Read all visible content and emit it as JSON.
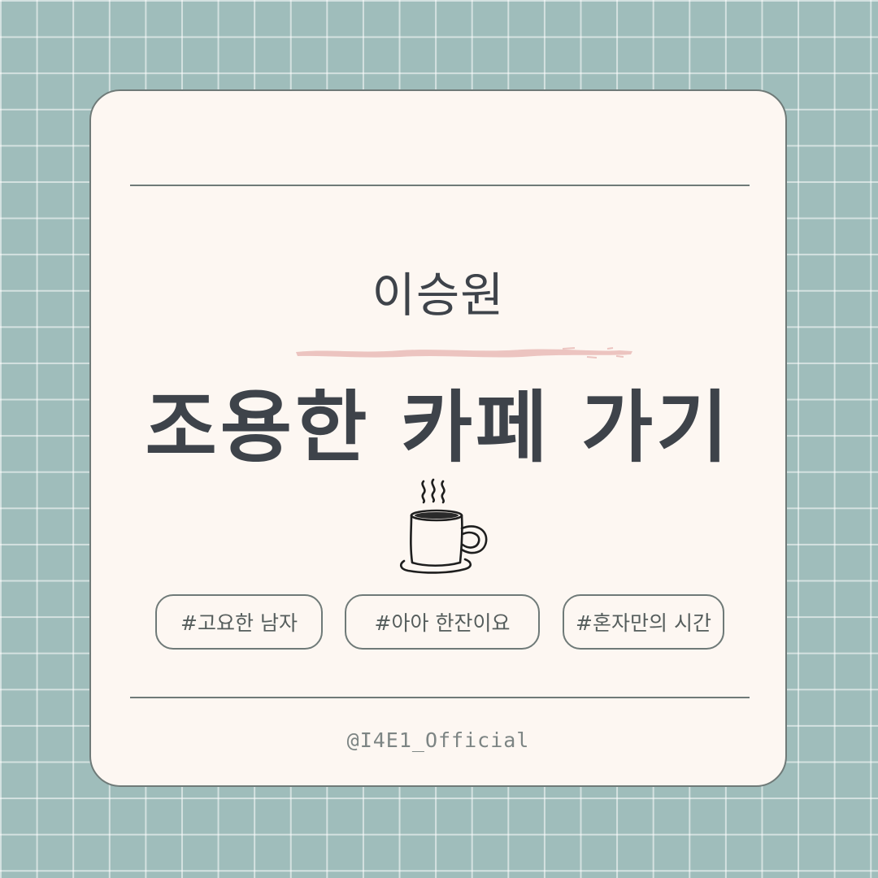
{
  "card": {
    "name": "이승원",
    "title": "조용한 카페 가기",
    "icon": "coffee-cup-icon",
    "tags": [
      "#고요한 남자",
      "#아아 한잔이요",
      "#혼자만의 시간"
    ],
    "handle": "@I4E1_Official"
  },
  "colors": {
    "background": "#9fbdbb",
    "card": "#fdf7f2",
    "text": "#3e434a",
    "accent_brush": "#ecc4c0"
  }
}
